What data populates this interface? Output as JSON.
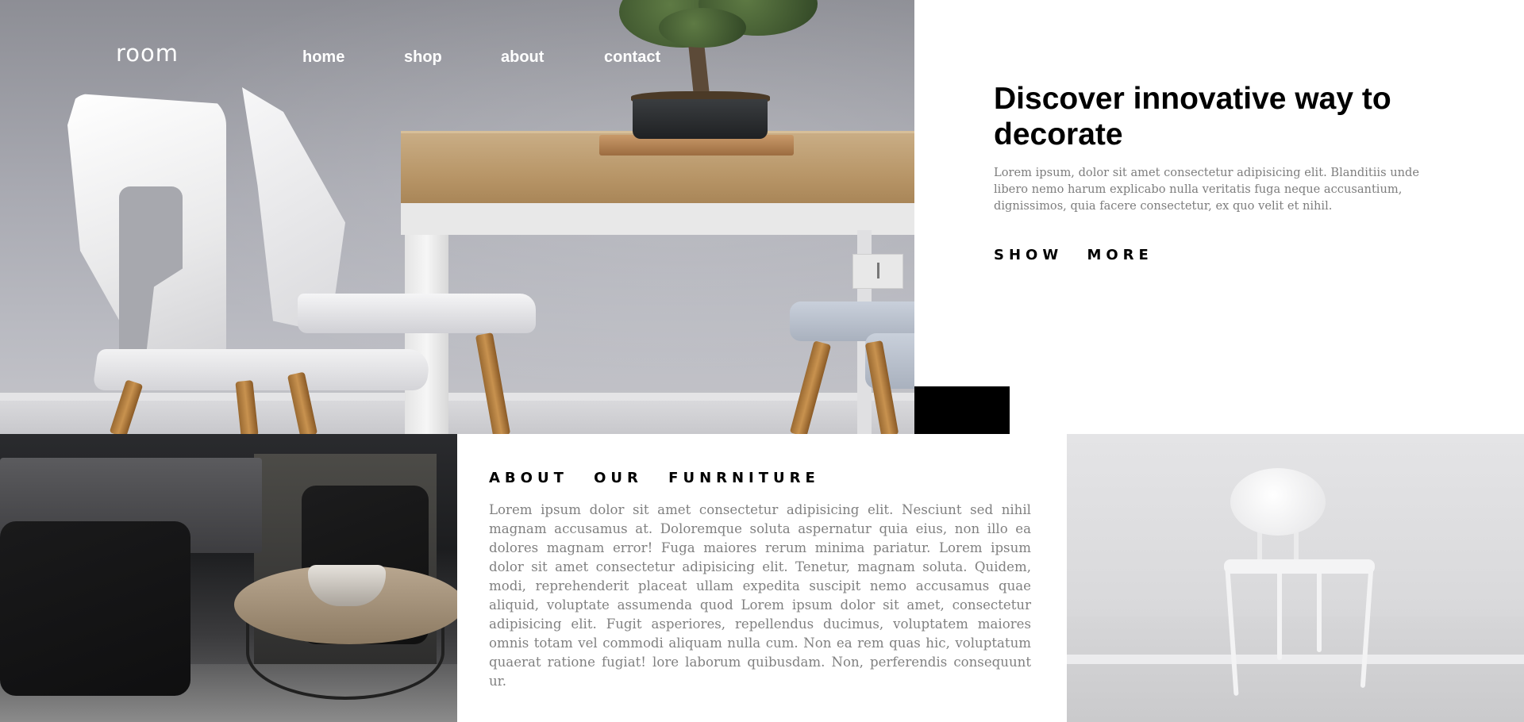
{
  "brand": {
    "logo": "room"
  },
  "nav": {
    "items": [
      {
        "label": "home"
      },
      {
        "label": "shop"
      },
      {
        "label": "about"
      },
      {
        "label": "contact"
      }
    ]
  },
  "hero": {
    "title": "Discover innovative way to decorate",
    "description": "Lorem ipsum, dolor sit amet consectetur adipisicing elit. Blanditiis unde libero nemo harum explicabo nulla veritatis fuga neque accusantium, dignissimos, quia facere consectetur, ex quo velit et nihil.",
    "cta_label": "SHOW MORE"
  },
  "about": {
    "title": "ABOUT OUR FUNRNITURE",
    "text": "Lorem ipsum dolor sit amet consectetur adipisicing elit. Nesciunt sed nihil magnam accusamus at. Doloremque soluta aspernatur quia eius, non illo ea dolores magnam error! Fuga maiores rerum minima pariatur. Lorem ipsum dolor sit amet consectetur adipisicing elit. Tenetur, magnam soluta. Quidem, modi, reprehenderit placeat ullam expedita suscipit nemo accusamus quae aliquid, voluptate assumenda quod Lorem ipsum dolor sit amet, consectetur adipisicing elit. Fugit asperiores, repellendus ducimus, voluptatem maiores omnis totam vel commodi aliquam nulla cum. Non ea rem quas hic, voluptatum quaerat ratione fugiat! lore laborum quibusdam. Non, perferendis consequunt ur."
  },
  "colors": {
    "text_primary": "#000000",
    "text_muted": "#7d7d7d",
    "nav_text": "#ffffff",
    "accent_block": "#000000"
  }
}
